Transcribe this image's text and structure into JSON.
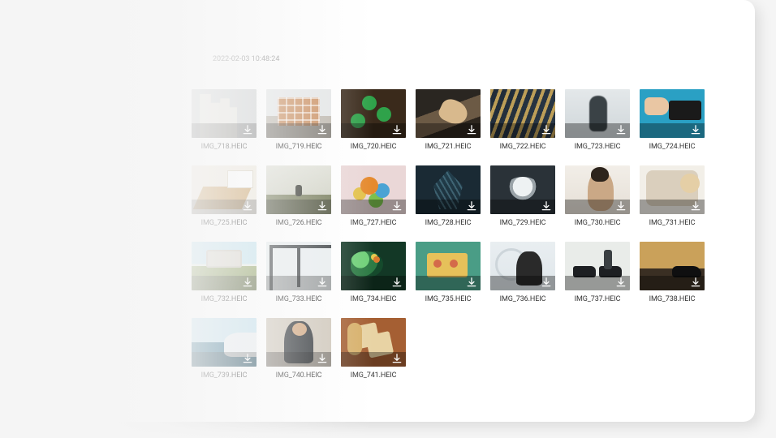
{
  "timestamp": "2022-02-03 10:48:24",
  "files": [
    {
      "caption": "IMG_718.HEIC",
      "art": "art-718"
    },
    {
      "caption": "IMG_719.HEIC",
      "art": "art-719"
    },
    {
      "caption": "IMG_720.HEIC",
      "art": "art-720"
    },
    {
      "caption": "IMG_721.HEIC",
      "art": "art-721"
    },
    {
      "caption": "IMG_722.HEIC",
      "art": "art-722"
    },
    {
      "caption": "IMG_723.HEIC",
      "art": "art-723"
    },
    {
      "caption": "IMG_724.HEIC",
      "art": "art-724"
    },
    {
      "caption": "IMG_725.HEIC",
      "art": "art-725"
    },
    {
      "caption": "IMG_726.HEIC",
      "art": "art-726"
    },
    {
      "caption": "IMG_727.HEIC",
      "art": "art-727"
    },
    {
      "caption": "IMG_728.HEIC",
      "art": "art-728"
    },
    {
      "caption": "IMG_729.HEIC",
      "art": "art-729"
    },
    {
      "caption": "IMG_730.HEIC",
      "art": "art-730"
    },
    {
      "caption": "IMG_731.HEIC",
      "art": "art-731"
    },
    {
      "caption": "IMG_732.HEIC",
      "art": "art-732"
    },
    {
      "caption": "IMG_733.HEIC",
      "art": "art-733"
    },
    {
      "caption": "IMG_734.HEIC",
      "art": "art-734"
    },
    {
      "caption": "IMG_735.HEIC",
      "art": "art-735"
    },
    {
      "caption": "IMG_736.HEIC",
      "art": "art-736"
    },
    {
      "caption": "IMG_737.HEIC",
      "art": "art-737"
    },
    {
      "caption": "IMG_738.HEIC",
      "art": "art-738"
    },
    {
      "caption": "IMG_739.HEIC",
      "art": "art-739"
    },
    {
      "caption": "IMG_740.HEIC",
      "art": "art-740"
    },
    {
      "caption": "IMG_741.HEIC",
      "art": "art-741"
    }
  ]
}
